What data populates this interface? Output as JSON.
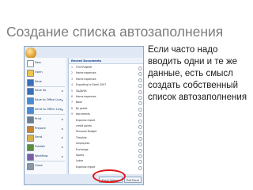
{
  "slide": {
    "title": "Создание списка автозаполнения",
    "bullet": "Если часто надо вводить одни и те же данные, есть смысл создать собственный список автозаполнения"
  },
  "menu": {
    "left_items": [
      {
        "label": "New",
        "icon": "new-document-icon",
        "color": "#ffffff",
        "arrow": ""
      },
      {
        "label": "Open",
        "icon": "open-folder-icon",
        "color": "#f0c64a",
        "arrow": ""
      },
      {
        "label": "Save",
        "icon": "save-disk-icon",
        "color": "#3b6fb6",
        "arrow": ""
      },
      {
        "label": "Save As",
        "icon": "save-as-icon",
        "color": "#3b6fb6",
        "arrow": "▸"
      },
      {
        "label": "Save to Office Live",
        "icon": "office-live-icon",
        "color": "#4a8ad0",
        "arrow": "▸"
      },
      {
        "label": "Send to Office Live",
        "icon": "send-icon",
        "color": "#4a8ad0",
        "arrow": "▸"
      },
      {
        "label": "Print",
        "icon": "printer-icon",
        "color": "#6d7d92",
        "arrow": "▸"
      },
      {
        "label": "Prepare",
        "icon": "prepare-icon",
        "color": "#c9852d",
        "arrow": "▸"
      },
      {
        "label": "Send",
        "icon": "envelope-icon",
        "color": "#d9b24a",
        "arrow": "▸"
      },
      {
        "label": "Publish",
        "icon": "publish-icon",
        "color": "#5a8f3a",
        "arrow": "▸"
      },
      {
        "label": "Workflow",
        "icon": "workflow-icon",
        "color": "#7a5fa8",
        "arrow": "▸"
      },
      {
        "label": "Close",
        "icon": "close-icon",
        "color": "#8a96a8",
        "arrow": ""
      }
    ],
    "recent_header": "Recent Documents",
    "recent": [
      {
        "num": "1",
        "name": "ГЕОГРАФИЯ"
      },
      {
        "num": "2",
        "name": "Home expenses"
      },
      {
        "num": "3",
        "name": "Home expenses"
      },
      {
        "num": "4",
        "name": "Exporting to Excel 2007"
      },
      {
        "num": "5",
        "name": "ЗАДАЧИ"
      },
      {
        "num": "6",
        "name": "Home expenses"
      },
      {
        "num": "7",
        "name": "Book"
      },
      {
        "num": "8",
        "name": "By grade"
      },
      {
        "num": "9",
        "name": "documents"
      },
      {
        "num": "",
        "name": "Expense report"
      },
      {
        "num": "",
        "name": "credit points"
      },
      {
        "num": "",
        "name": "Personal Budget"
      },
      {
        "num": "",
        "name": "Timeline"
      },
      {
        "num": "",
        "name": "employees"
      },
      {
        "num": "",
        "name": "Exchange"
      },
      {
        "num": "",
        "name": "Sports"
      },
      {
        "num": "",
        "name": "Labor"
      },
      {
        "num": "",
        "name": "Expense report"
      }
    ],
    "options_button": "Excel Options",
    "exit_button": "Exit Excel"
  },
  "colors": {
    "title": "#7b7b7b",
    "highlight": "#e0141b",
    "office_blue": "#15428b"
  }
}
